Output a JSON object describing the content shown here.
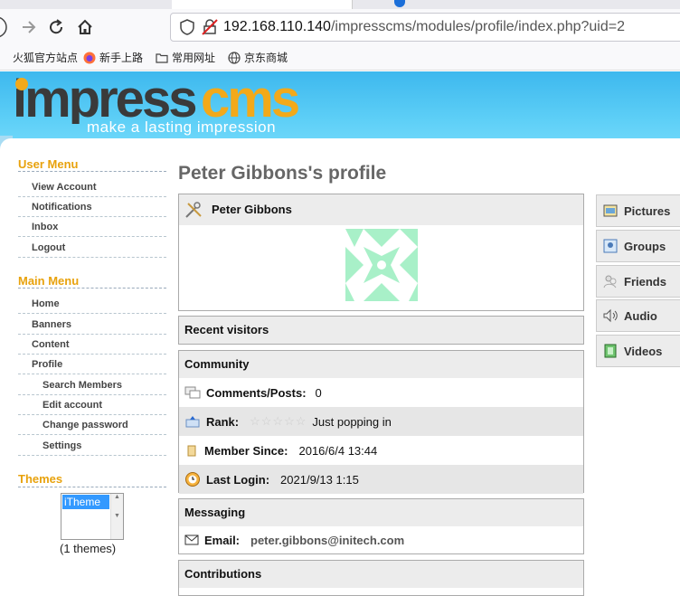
{
  "browser": {
    "url_host": "192.168.110.140",
    "url_path": "/impresscms/modules/profile/index.php?uid=2",
    "bookmarks": [
      "火狐官方站点",
      "新手上路",
      "常用网址",
      "京东商城"
    ]
  },
  "site": {
    "logo_part1": "impress",
    "logo_part2": "cms",
    "tagline": "make a lasting impression"
  },
  "user_menu": {
    "title": "User Menu",
    "items": [
      "View Account",
      "Notifications",
      "Inbox",
      "Logout"
    ]
  },
  "main_menu": {
    "title": "Main Menu",
    "items": [
      "Home",
      "Banners",
      "Content",
      "Profile"
    ],
    "sub_items": [
      "Search Members",
      "Edit account",
      "Change password",
      "Settings"
    ]
  },
  "themes": {
    "title": "Themes",
    "selected": "iTheme",
    "count": "(1 themes)"
  },
  "profile": {
    "title": "Peter Gibbons's profile",
    "name": "Peter Gibbons",
    "recent_visitors": "Recent visitors",
    "community": {
      "title": "Community",
      "comments_label": "Comments/Posts:",
      "comments_value": "0",
      "rank_label": "Rank:",
      "rank_stars": 0,
      "rank_value": "Just popping in",
      "member_since_label": "Member Since:",
      "member_since_value": "2016/6/4 13:44",
      "last_login_label": "Last Login:",
      "last_login_value": "2021/9/13 1:15"
    },
    "messaging": {
      "title": "Messaging",
      "email_label": "Email:",
      "email_value": "peter.gibbons@initech.com"
    },
    "contributions": "Contributions"
  },
  "right_tabs": [
    "Pictures",
    "Groups",
    "Friends",
    "Audio",
    "Videos"
  ],
  "colors": {
    "accent": "#e8a20d",
    "banner": "#4cc4f2",
    "identicon": "#a8f0c8"
  }
}
